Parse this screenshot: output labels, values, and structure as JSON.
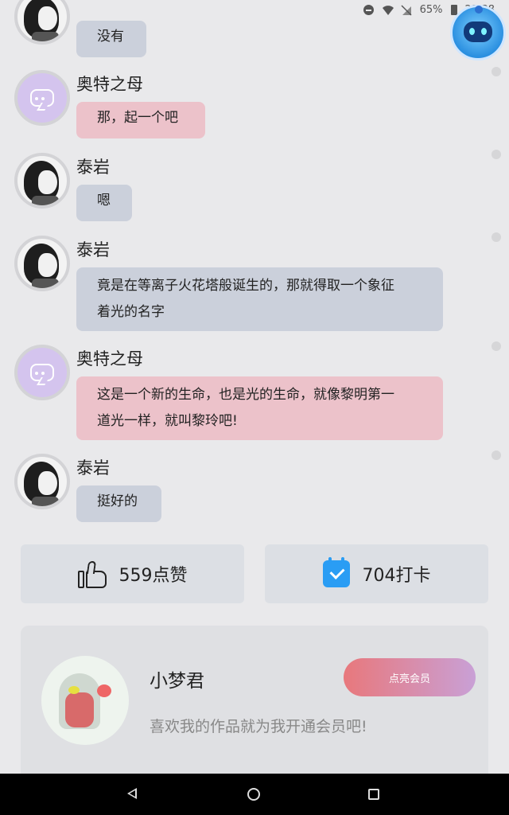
{
  "status_bar": {
    "battery_percent": "65%",
    "time": "22:38"
  },
  "messages": [
    {
      "speaker": "",
      "avatar": "taiyan",
      "text": "没有",
      "style": "grey"
    },
    {
      "speaker": "奥特之母",
      "avatar": "mother-of-ultra",
      "text": "那，起一个吧",
      "style": "pink"
    },
    {
      "speaker": "泰岩",
      "avatar": "taiyan",
      "text": "嗯",
      "style": "grey"
    },
    {
      "speaker": "泰岩",
      "avatar": "taiyan",
      "text_lines": [
        "竟是在等离子火花塔般诞生的，那就得取一个象征",
        "着光的名字"
      ],
      "style": "grey"
    },
    {
      "speaker": "奥特之母",
      "avatar": "mother-of-ultra",
      "text_lines": [
        "这是一个新的生命，也是光的生命，就像黎明第一",
        "道光一样，就叫黎玲吧!"
      ],
      "style": "pink"
    },
    {
      "speaker": "泰岩",
      "avatar": "taiyan",
      "text": "挺好的",
      "style": "grey"
    }
  ],
  "actions": {
    "like_label": "559点赞",
    "checkin_label": "704打卡"
  },
  "author": {
    "name": "小梦君",
    "description": "喜欢我的作品就为我开通会员吧!",
    "vip_button_label": "点亮会员"
  },
  "colors": {
    "background": "#e9e9eb",
    "bubble_grey": "#cbd0db",
    "bubble_pink": "#ecc2ca",
    "calendar_blue": "#2a9df4"
  }
}
